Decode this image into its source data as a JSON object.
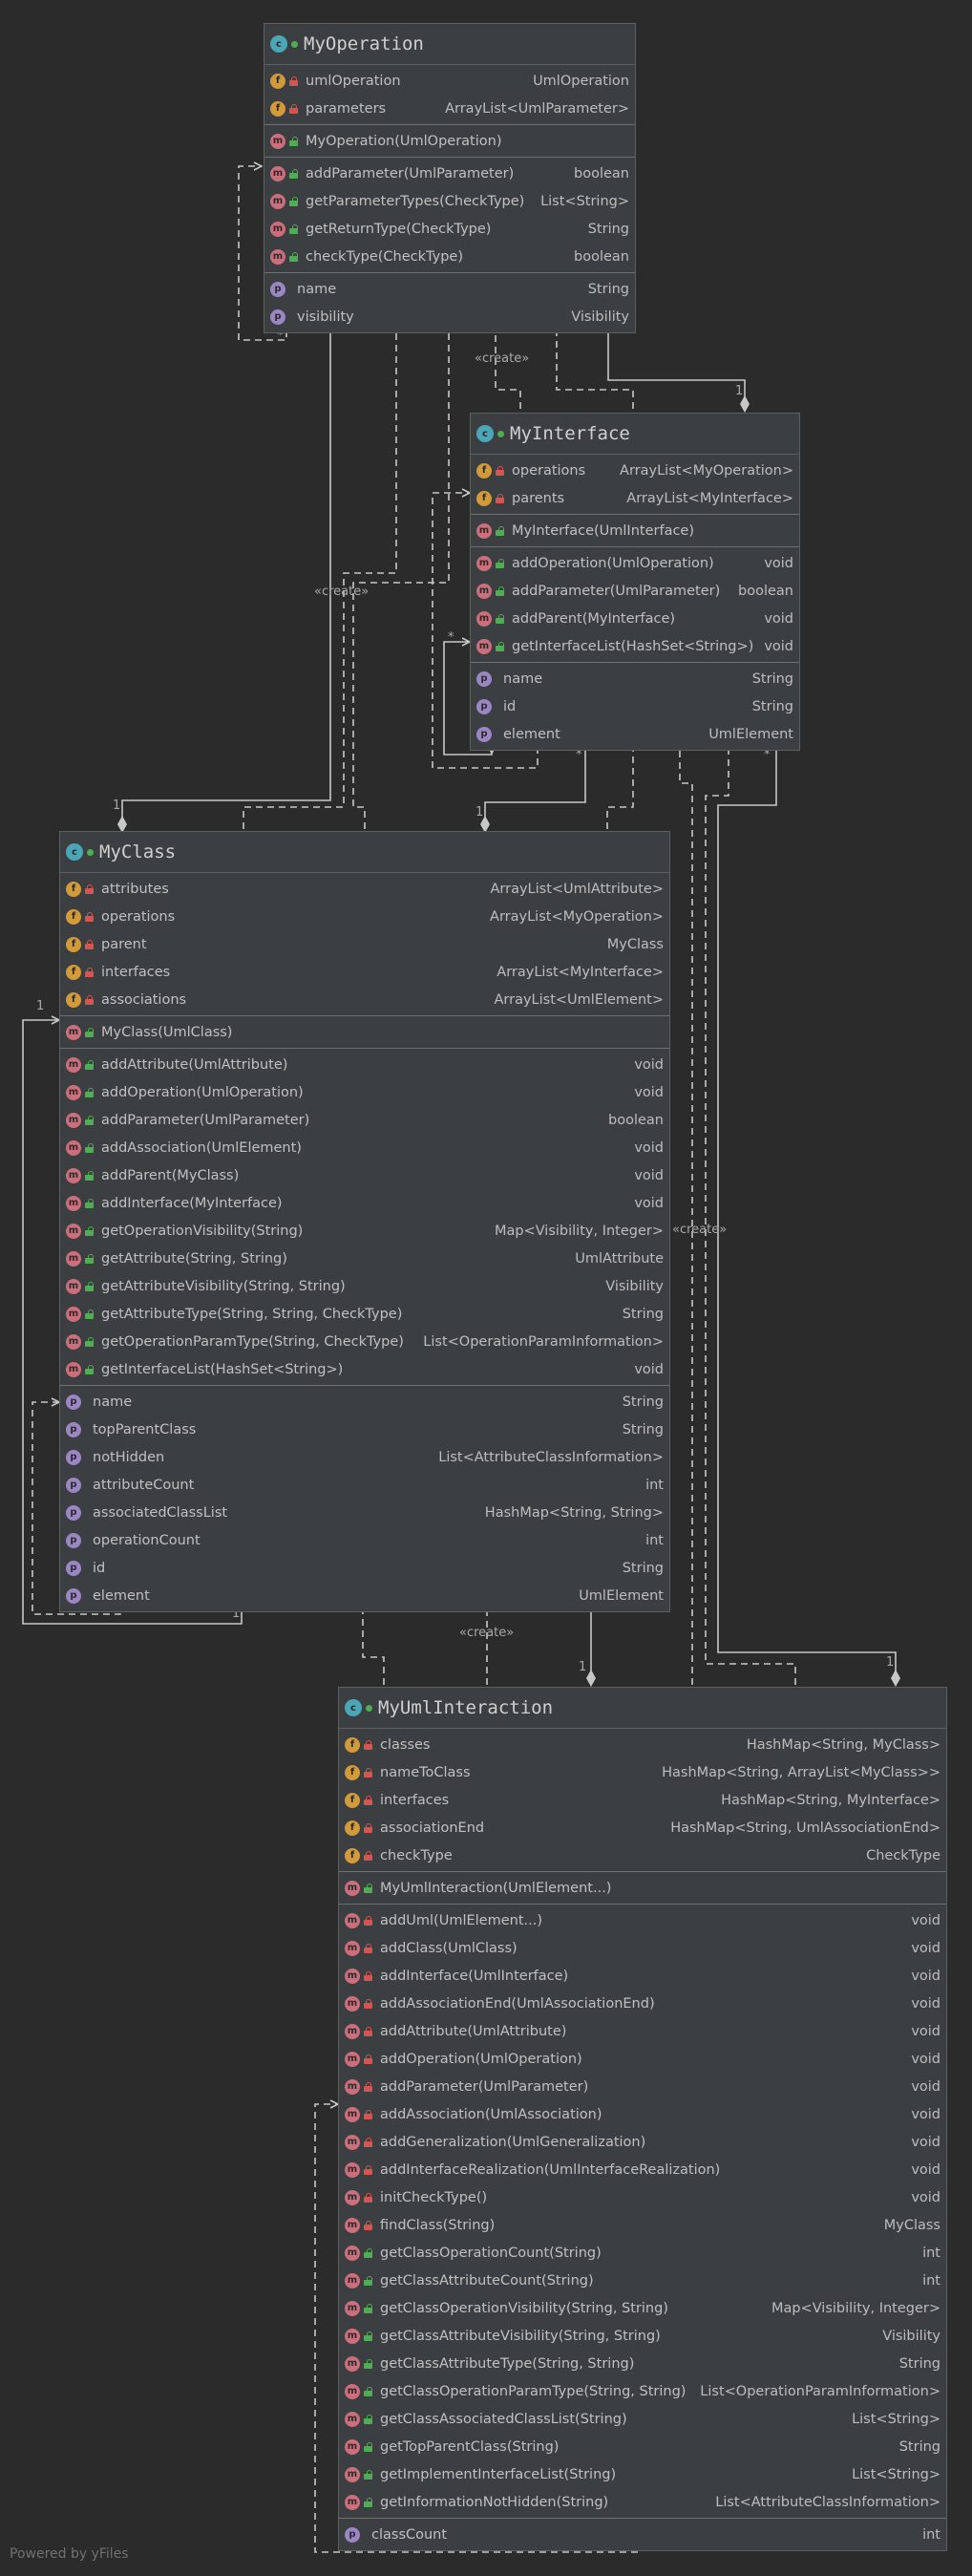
{
  "classes": {
    "op": {
      "name": "MyOperation",
      "sections": [
        [
          {
            "kind": "f",
            "vis": "priv",
            "name": "umlOperation",
            "type": "UmlOperation"
          },
          {
            "kind": "f",
            "vis": "priv",
            "name": "parameters",
            "type": "ArrayList<UmlParameter>"
          }
        ],
        [
          {
            "kind": "m",
            "vis": "pub",
            "name": "MyOperation(UmlOperation)",
            "type": ""
          }
        ],
        [
          {
            "kind": "m",
            "vis": "pub",
            "name": "addParameter(UmlParameter)",
            "type": "boolean"
          },
          {
            "kind": "m",
            "vis": "pub",
            "name": "getParameterTypes(CheckType)",
            "type": "List<String>"
          },
          {
            "kind": "m",
            "vis": "pub",
            "name": "getReturnType(CheckType)",
            "type": "String"
          },
          {
            "kind": "m",
            "vis": "pub",
            "name": "checkType(CheckType)",
            "type": "boolean"
          }
        ],
        [
          {
            "kind": "p",
            "vis": "none",
            "name": "name",
            "type": "String"
          },
          {
            "kind": "p",
            "vis": "none",
            "name": "visibility",
            "type": "Visibility"
          }
        ]
      ]
    },
    "iface": {
      "name": "MyInterface",
      "sections": [
        [
          {
            "kind": "f",
            "vis": "priv",
            "name": "operations",
            "type": "ArrayList<MyOperation>"
          },
          {
            "kind": "f",
            "vis": "priv",
            "name": "parents",
            "type": "ArrayList<MyInterface>"
          }
        ],
        [
          {
            "kind": "m",
            "vis": "pub",
            "name": "MyInterface(UmlInterface)",
            "type": ""
          }
        ],
        [
          {
            "kind": "m",
            "vis": "pub",
            "name": "addOperation(UmlOperation)",
            "type": "void"
          },
          {
            "kind": "m",
            "vis": "pub",
            "name": "addParameter(UmlParameter)",
            "type": "boolean"
          },
          {
            "kind": "m",
            "vis": "pub",
            "name": "addParent(MyInterface)",
            "type": "void"
          },
          {
            "kind": "m",
            "vis": "pub",
            "name": "getInterfaceList(HashSet<String>)",
            "type": "void"
          }
        ],
        [
          {
            "kind": "p",
            "vis": "none",
            "name": "name",
            "type": "String"
          },
          {
            "kind": "p",
            "vis": "none",
            "name": "id",
            "type": "String"
          },
          {
            "kind": "p",
            "vis": "none",
            "name": "element",
            "type": "UmlElement"
          }
        ]
      ]
    },
    "cls": {
      "name": "MyClass",
      "sections": [
        [
          {
            "kind": "f",
            "vis": "priv",
            "name": "attributes",
            "type": "ArrayList<UmlAttribute>"
          },
          {
            "kind": "f",
            "vis": "priv",
            "name": "operations",
            "type": "ArrayList<MyOperation>"
          },
          {
            "kind": "f",
            "vis": "priv",
            "name": "parent",
            "type": "MyClass"
          },
          {
            "kind": "f",
            "vis": "priv",
            "name": "interfaces",
            "type": "ArrayList<MyInterface>"
          },
          {
            "kind": "f",
            "vis": "priv",
            "name": "associations",
            "type": "ArrayList<UmlElement>"
          }
        ],
        [
          {
            "kind": "m",
            "vis": "pub",
            "name": "MyClass(UmlClass)",
            "type": ""
          }
        ],
        [
          {
            "kind": "m",
            "vis": "pub",
            "name": "addAttribute(UmlAttribute)",
            "type": "void"
          },
          {
            "kind": "m",
            "vis": "pub",
            "name": "addOperation(UmlOperation)",
            "type": "void"
          },
          {
            "kind": "m",
            "vis": "pub",
            "name": "addParameter(UmlParameter)",
            "type": "boolean"
          },
          {
            "kind": "m",
            "vis": "pub",
            "name": "addAssociation(UmlElement)",
            "type": "void"
          },
          {
            "kind": "m",
            "vis": "pub",
            "name": "addParent(MyClass)",
            "type": "void"
          },
          {
            "kind": "m",
            "vis": "pub",
            "name": "addInterface(MyInterface)",
            "type": "void"
          },
          {
            "kind": "m",
            "vis": "pub",
            "name": "getOperationVisibility(String)",
            "type": "Map<Visibility, Integer>"
          },
          {
            "kind": "m",
            "vis": "pub",
            "name": "getAttribute(String, String)",
            "type": "UmlAttribute"
          },
          {
            "kind": "m",
            "vis": "pub",
            "name": "getAttributeVisibility(String, String)",
            "type": "Visibility"
          },
          {
            "kind": "m",
            "vis": "pub",
            "name": "getAttributeType(String, String, CheckType)",
            "type": "String"
          },
          {
            "kind": "m",
            "vis": "pub",
            "name": "getOperationParamType(String, CheckType)",
            "type": "List<OperationParamInformation>"
          },
          {
            "kind": "m",
            "vis": "pub",
            "name": "getInterfaceList(HashSet<String>)",
            "type": "void"
          }
        ],
        [
          {
            "kind": "p",
            "vis": "none",
            "name": "name",
            "type": "String"
          },
          {
            "kind": "p",
            "vis": "none",
            "name": "topParentClass",
            "type": "String"
          },
          {
            "kind": "p",
            "vis": "none",
            "name": "notHidden",
            "type": "List<AttributeClassInformation>"
          },
          {
            "kind": "p",
            "vis": "none",
            "name": "attributeCount",
            "type": "int"
          },
          {
            "kind": "p",
            "vis": "none",
            "name": "associatedClassList",
            "type": "HashMap<String, String>"
          },
          {
            "kind": "p",
            "vis": "none",
            "name": "operationCount",
            "type": "int"
          },
          {
            "kind": "p",
            "vis": "none",
            "name": "id",
            "type": "String"
          },
          {
            "kind": "p",
            "vis": "none",
            "name": "element",
            "type": "UmlElement"
          }
        ]
      ]
    },
    "uml": {
      "name": "MyUmlInteraction",
      "sections": [
        [
          {
            "kind": "f",
            "vis": "priv",
            "name": "classes",
            "type": "HashMap<String, MyClass>"
          },
          {
            "kind": "f",
            "vis": "priv",
            "name": "nameToClass",
            "type": "HashMap<String, ArrayList<MyClass>>"
          },
          {
            "kind": "f",
            "vis": "priv",
            "name": "interfaces",
            "type": "HashMap<String, MyInterface>"
          },
          {
            "kind": "f",
            "vis": "priv",
            "name": "associationEnd",
            "type": "HashMap<String, UmlAssociationEnd>"
          },
          {
            "kind": "f",
            "vis": "priv",
            "name": "checkType",
            "type": "CheckType"
          }
        ],
        [
          {
            "kind": "m",
            "vis": "pub",
            "name": "MyUmlInteraction(UmlElement...)",
            "type": ""
          }
        ],
        [
          {
            "kind": "m",
            "vis": "priv",
            "name": "addUml(UmlElement...)",
            "type": "void"
          },
          {
            "kind": "m",
            "vis": "priv",
            "name": "addClass(UmlClass)",
            "type": "void"
          },
          {
            "kind": "m",
            "vis": "priv",
            "name": "addInterface(UmlInterface)",
            "type": "void"
          },
          {
            "kind": "m",
            "vis": "priv",
            "name": "addAssociationEnd(UmlAssociationEnd)",
            "type": "void"
          },
          {
            "kind": "m",
            "vis": "priv",
            "name": "addAttribute(UmlAttribute)",
            "type": "void"
          },
          {
            "kind": "m",
            "vis": "priv",
            "name": "addOperation(UmlOperation)",
            "type": "void"
          },
          {
            "kind": "m",
            "vis": "priv",
            "name": "addParameter(UmlParameter)",
            "type": "void"
          },
          {
            "kind": "m",
            "vis": "priv",
            "name": "addAssociation(UmlAssociation)",
            "type": "void"
          },
          {
            "kind": "m",
            "vis": "priv",
            "name": "addGeneralization(UmlGeneralization)",
            "type": "void"
          },
          {
            "kind": "m",
            "vis": "priv",
            "name": "addInterfaceRealization(UmlInterfaceRealization)",
            "type": "void"
          },
          {
            "kind": "m",
            "vis": "priv",
            "name": "initCheckType()",
            "type": "void"
          },
          {
            "kind": "m",
            "vis": "priv",
            "name": "findClass(String)",
            "type": "MyClass"
          },
          {
            "kind": "m",
            "vis": "pub",
            "name": "getClassOperationCount(String)",
            "type": "int"
          },
          {
            "kind": "m",
            "vis": "pub",
            "name": "getClassAttributeCount(String)",
            "type": "int"
          },
          {
            "kind": "m",
            "vis": "pub",
            "name": "getClassOperationVisibility(String, String)",
            "type": "Map<Visibility, Integer>"
          },
          {
            "kind": "m",
            "vis": "pub",
            "name": "getClassAttributeVisibility(String, String)",
            "type": "Visibility"
          },
          {
            "kind": "m",
            "vis": "pub",
            "name": "getClassAttributeType(String, String)",
            "type": "String"
          },
          {
            "kind": "m",
            "vis": "pub",
            "name": "getClassOperationParamType(String, String)",
            "type": "List<OperationParamInformation>"
          },
          {
            "kind": "m",
            "vis": "pub",
            "name": "getClassAssociatedClassList(String)",
            "type": "List<String>"
          },
          {
            "kind": "m",
            "vis": "pub",
            "name": "getTopParentClass(String)",
            "type": "String"
          },
          {
            "kind": "m",
            "vis": "pub",
            "name": "getImplementInterfaceList(String)",
            "type": "List<String>"
          },
          {
            "kind": "m",
            "vis": "pub",
            "name": "getInformationNotHidden(String)",
            "type": "List<AttributeClassInformation>"
          }
        ],
        [
          {
            "kind": "p",
            "vis": "none",
            "name": "classCount",
            "type": "int"
          }
        ]
      ]
    }
  },
  "labels": {
    "create": "«create»",
    "mult_one": "1",
    "mult_many": "*"
  },
  "footer": "Powered by yFiles",
  "colors": {
    "background": "#2b2b2b",
    "node_fill": "#3c3f41",
    "edge": "#c8c8c8",
    "field_icon": "#d29a39",
    "method_icon": "#cc6e7b",
    "property_icon": "#9b86c4",
    "class_icon": "#4aa7b8"
  }
}
